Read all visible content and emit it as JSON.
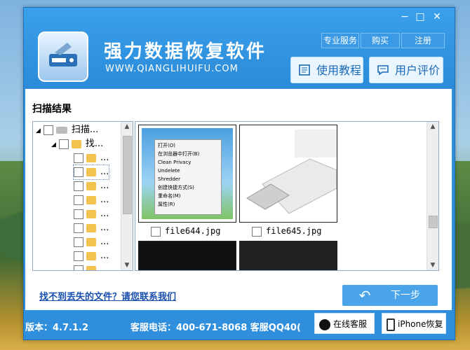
{
  "window": {
    "controls": [
      "−",
      "□",
      "✕"
    ],
    "app_title": "强力数据恢复软件",
    "app_url": "WWW.QIANGLIHUIFU.COM",
    "top_links": [
      "专业服务",
      "购买",
      "注册"
    ],
    "big_buttons": [
      {
        "label": "使用教程",
        "icon": "book-icon"
      },
      {
        "label": "用户评价",
        "icon": "comment-icon"
      }
    ]
  },
  "panel": {
    "section_title": "扫描结果",
    "tree": {
      "root_label": "扫描...",
      "child_label": "找...",
      "sub_label": "..."
    },
    "context_menu": {
      "items": [
        "打开(O)",
        "在浏览器中打开(B)",
        "Clean Privacy",
        "Undelete",
        "Shredder",
        "创建快捷方式(S)",
        "重命名(M)",
        "属性(R)"
      ]
    },
    "files": [
      {
        "name": "file644.jpg"
      },
      {
        "name": "file645.jpg"
      }
    ],
    "help_link": "找不到丢失的文件？请您联系我们",
    "back_button": "↶",
    "next_button": "下一步"
  },
  "footer": {
    "version": "版本：4.7.1.2",
    "phone": "客服电话：400-671-8068 客服QQ40(",
    "online_service": "在线客服",
    "iphone_recovery": "iPhone恢复"
  },
  "colors": {
    "titlebar": "#2f8fdc",
    "accent_button": "#4aa4ea",
    "link": "#1a4fb0"
  }
}
